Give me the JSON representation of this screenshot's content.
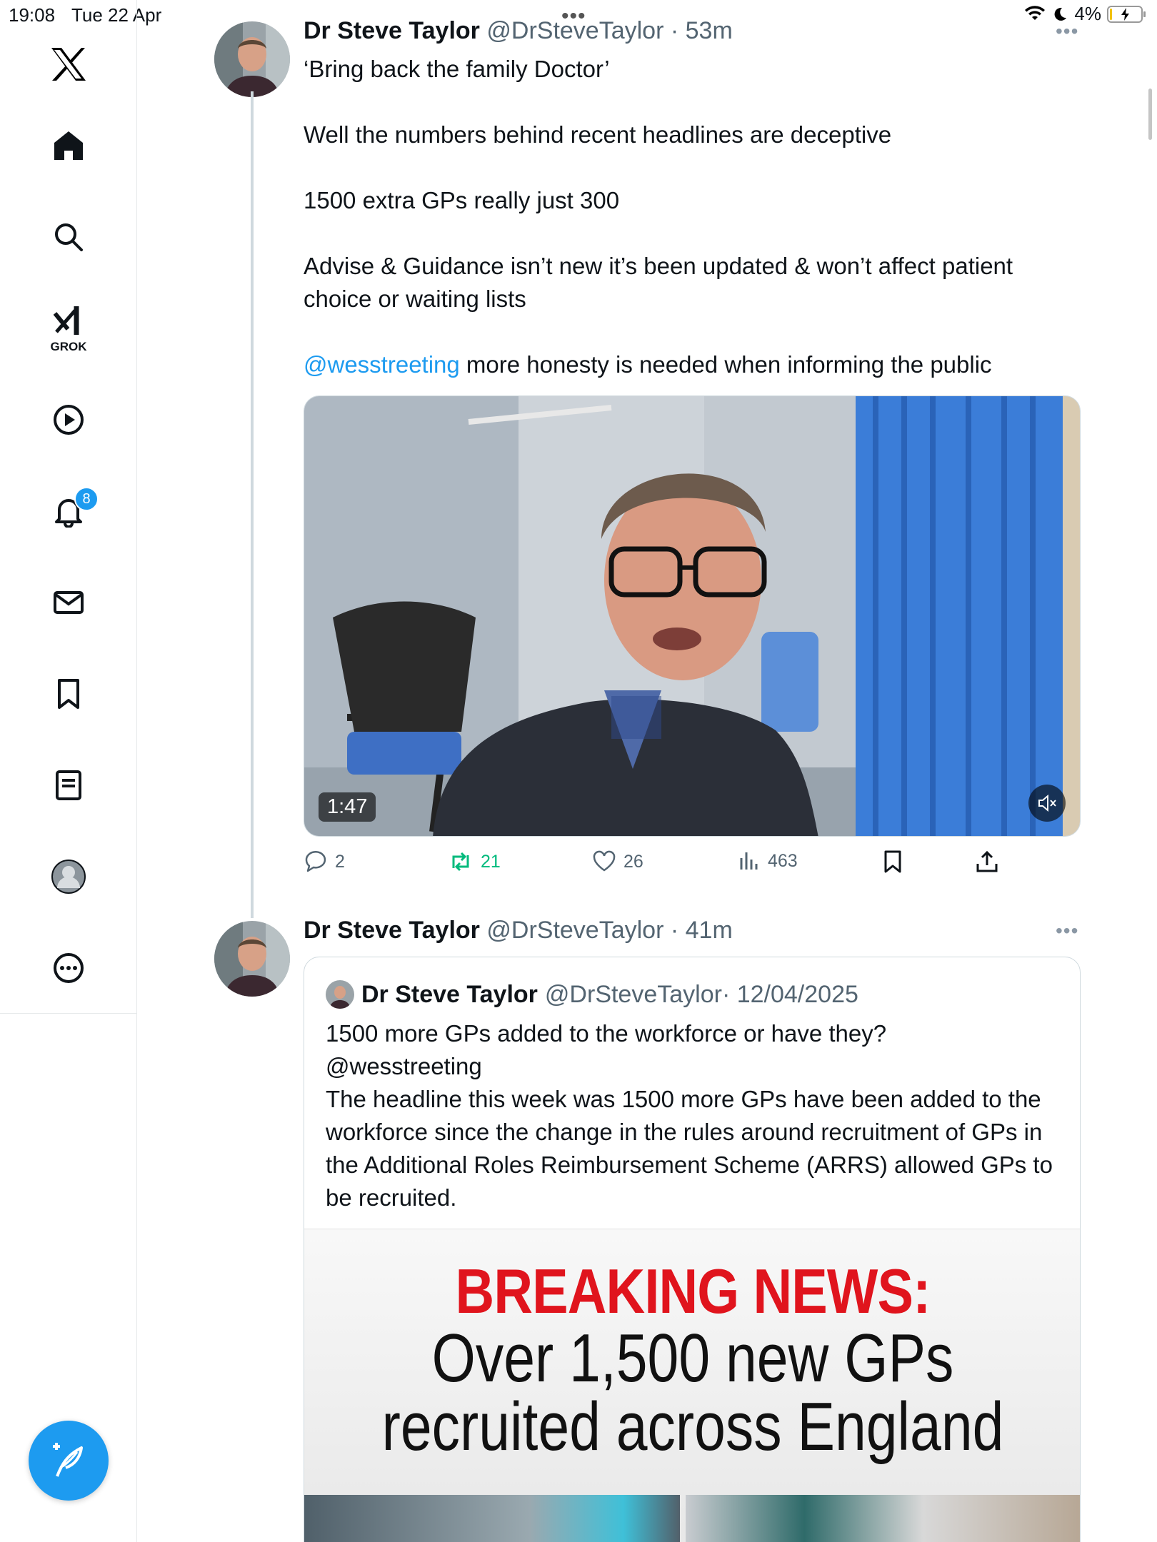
{
  "status_bar": {
    "time": "19:08",
    "date": "Tue 22 Apr",
    "battery": "4%",
    "battery_level": 0.04
  },
  "sidebar": {
    "grok_label": "GROK",
    "notifications_badge": "8",
    "items": [
      "x-logo",
      "home-icon",
      "search-icon",
      "grok-icon",
      "video-icon",
      "notifications-icon",
      "messages-icon",
      "bookmarks-icon",
      "lists-icon",
      "profile-icon",
      "more-icon"
    ]
  },
  "tweet1": {
    "name": "Dr Steve Taylor",
    "handle": "@DrSteveTaylor",
    "time": "· 53m",
    "lines": [
      "‘Bring back the family Doctor’",
      "Well the numbers behind recent headlines are deceptive",
      "1500 extra GPs really just 300",
      "Advise & Guidance isn’t new it’s been updated & won’t affect patient choice or waiting lists"
    ],
    "mention": "@wesstreeting",
    "mention_tail": " more honesty is needed when informing the public",
    "video_duration": "1:47",
    "replies": "2",
    "reposts": "21",
    "likes": "26",
    "views": "463"
  },
  "tweet2": {
    "name": "Dr Steve Taylor",
    "handle": "@DrSteveTaylor",
    "time": "· 41m",
    "quote": {
      "name": "Dr Steve Taylor",
      "handle": "@DrSteveTaylor",
      "time": "· 12/04/2025",
      "line1": "1500 more GPs added to the workforce or have they?",
      "line2": "@wesstreeting",
      "line3": "The headline this week was 1500 more GPs have been added to the workforce since the change in the rules around recruitment of GPs in the Additional Roles Reimbursement Scheme (ARRS) allowed GPs to be recruited.",
      "image_headline": "BREAKING NEWS:",
      "image_line2": "Over 1,500 new GPs",
      "image_line3": "recruited across England"
    }
  },
  "colors": {
    "accent": "#1d9bf0",
    "repost_active": "#00ba7c",
    "breaking_red": "#e0141d",
    "muted_text": "#536471"
  }
}
